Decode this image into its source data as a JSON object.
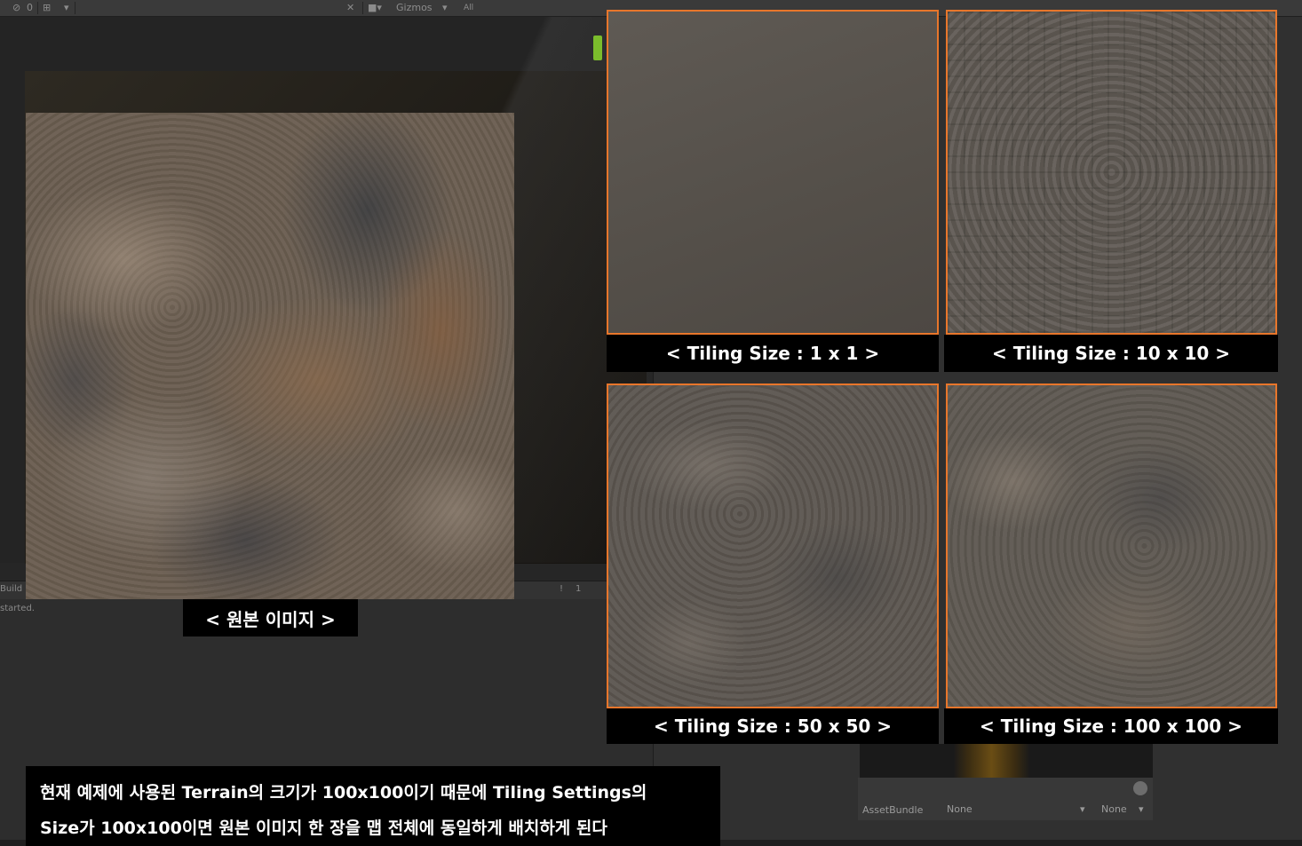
{
  "toolbar": {
    "hidden_count": "0",
    "gizmos_label": "Gizmos",
    "search_placeholder": "All"
  },
  "console": {
    "build_text": "Build",
    "started_text": "started.",
    "count_text": "1"
  },
  "inspector": {
    "assetbundle_label": "AssetBundle",
    "assetbundle_value": "None",
    "variant_value": "None"
  },
  "captions": {
    "original": "< 원본 이미지 >",
    "tile_1": "< Tiling Size : 1 x 1 >",
    "tile_10": "< Tiling Size : 10 x 10 >",
    "tile_50": "< Tiling Size : 50 x 50 >",
    "tile_100": "< Tiling Size : 100 x 100 >"
  },
  "subtitle": {
    "line1": "현재 예제에 사용된 Terrain의 크기가 100x100이기 때문에 Tiling Settings의",
    "line2": "Size가 100x100이면 원본 이미지 한 장을 맵 전체에 동일하게 배치하게 된다"
  },
  "colors": {
    "panel_border": "#e8762b",
    "caption_bg": "#000000",
    "caption_text": "#ffffff",
    "editor_bg": "#262626"
  }
}
